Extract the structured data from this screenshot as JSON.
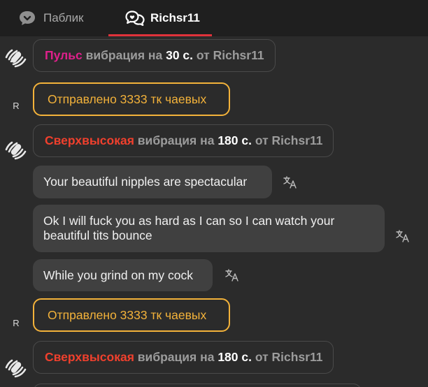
{
  "tabs": {
    "public_label": "Паблик",
    "user_label": "Richsr11"
  },
  "vibration_1": {
    "level": "Пульс",
    "mid": "вибрация на",
    "duration": "30 с.",
    "from": "от",
    "user": "Richsr11"
  },
  "tip_1": {
    "avatar": "R",
    "text": "Отправлено 3333 тк чаевых"
  },
  "vibration_2": {
    "level": "Сверхвысокая",
    "mid": "вибрация на",
    "duration": "180 с.",
    "from": "от",
    "user": "Richsr11"
  },
  "messages": [
    {
      "text": "Your beautiful nipples are spectacular"
    },
    {
      "text": "Ok I will fuck you as hard as I can so I can watch your beautiful tits bounce"
    },
    {
      "text": "While you grind on my cock"
    }
  ],
  "tip_2": {
    "avatar": "R",
    "text": "Отправлено 3333 тк чаевых"
  },
  "vibration_3": {
    "level": "Сверхвысокая",
    "mid": "вибрация на",
    "duration": "180 с.",
    "from": "от",
    "user": "Richsr11"
  },
  "colors": {
    "accent": "#e0323a",
    "tip": "#f3b23a",
    "pulse": "#e0208c",
    "ultra": "#f0402d"
  },
  "icons": {
    "public_tab": "chat-bubble-icon",
    "user_tab": "private-chat-icon",
    "vibration": "vibration-icon",
    "translate": "translate-icon"
  }
}
